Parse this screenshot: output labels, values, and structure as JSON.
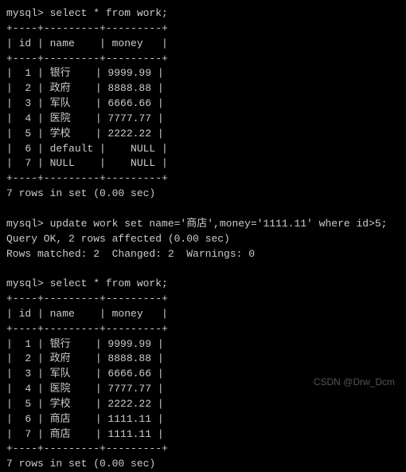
{
  "prompt_prefix": "mysql> ",
  "query1": {
    "sql": "select * from work;",
    "border_top": "+----+---------+---------+",
    "header": "| id | name    | money   |",
    "rows": [
      "|  1 | 银行    | 9999.99 |",
      "|  2 | 政府    | 8888.88 |",
      "|  3 | 军队    | 6666.66 |",
      "|  4 | 医院    | 7777.77 |",
      "|  5 | 学校    | 2222.22 |",
      "|  6 | default |    NULL |",
      "|  7 | NULL    |    NULL |"
    ],
    "summary": "7 rows in set (0.00 sec)"
  },
  "query2": {
    "sql": "update work set name='商店',money='1111.11' where id>5;",
    "result_line1": "Query OK, 2 rows affected (0.00 sec)",
    "result_line2": "Rows matched: 2  Changed: 2  Warnings: 0"
  },
  "query3": {
    "sql": "select * from work;",
    "border_top": "+----+---------+---------+",
    "header": "| id | name    | money   |",
    "rows": [
      "|  1 | 银行    | 9999.99 |",
      "|  2 | 政府    | 8888.88 |",
      "|  3 | 军队    | 6666.66 |",
      "|  4 | 医院    | 7777.77 |",
      "|  5 | 学校    | 2222.22 |",
      "|  6 | 商店    | 1111.11 |",
      "|  7 | 商店    | 1111.11 |"
    ],
    "summary": "7 rows in set (0.00 sec)"
  },
  "chart_data": {
    "type": "table",
    "tables": [
      {
        "title": "work (before update)",
        "columns": [
          "id",
          "name",
          "money"
        ],
        "rows": [
          [
            1,
            "银行",
            9999.99
          ],
          [
            2,
            "政府",
            8888.88
          ],
          [
            3,
            "军队",
            6666.66
          ],
          [
            4,
            "医院",
            7777.77
          ],
          [
            5,
            "学校",
            2222.22
          ],
          [
            6,
            "default",
            null
          ],
          [
            7,
            null,
            null
          ]
        ]
      },
      {
        "title": "work (after update)",
        "columns": [
          "id",
          "name",
          "money"
        ],
        "rows": [
          [
            1,
            "银行",
            9999.99
          ],
          [
            2,
            "政府",
            8888.88
          ],
          [
            3,
            "军队",
            6666.66
          ],
          [
            4,
            "医院",
            7777.77
          ],
          [
            5,
            "学校",
            2222.22
          ],
          [
            6,
            "商店",
            1111.11
          ],
          [
            7,
            "商店",
            1111.11
          ]
        ]
      }
    ]
  },
  "watermark": "CSDN @Drw_Dcm"
}
